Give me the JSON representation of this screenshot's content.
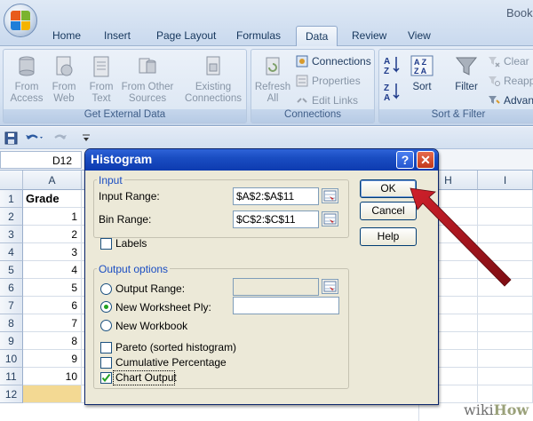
{
  "window": {
    "book_title": "Book"
  },
  "ribbon": {
    "tabs": [
      "Home",
      "Insert",
      "Page Layout",
      "Formulas",
      "Data",
      "Review",
      "View"
    ],
    "active_tab": "Data",
    "get_external_data": {
      "label": "Get External Data",
      "buttons": [
        {
          "line1": "From",
          "line2": "Access",
          "icon": "database-icon"
        },
        {
          "line1": "From",
          "line2": "Web",
          "icon": "globe-page-icon"
        },
        {
          "line1": "From",
          "line2": "Text",
          "icon": "text-file-icon"
        },
        {
          "line1": "From Other",
          "line2": "Sources",
          "icon": "other-sources-icon"
        },
        {
          "line1": "Existing",
          "line2": "Connections",
          "icon": "existing-connections-icon"
        }
      ]
    },
    "connections": {
      "label": "Connections",
      "refresh_line1": "Refresh",
      "refresh_line2": "All",
      "items": [
        "Connections",
        "Properties",
        "Edit Links"
      ]
    },
    "sort_filter": {
      "label": "Sort & Filter",
      "sort": "Sort",
      "filter": "Filter",
      "items": [
        "Clear",
        "Reapply",
        "Advanced"
      ]
    }
  },
  "name_box": "D12",
  "sheet": {
    "columns": [
      "A",
      "H",
      "I"
    ],
    "rows": [
      "1",
      "2",
      "3",
      "4",
      "5",
      "6",
      "7",
      "8",
      "9",
      "10",
      "11",
      "12"
    ],
    "a_values": [
      "Grade",
      "1",
      "2",
      "3",
      "4",
      "5",
      "6",
      "7",
      "8",
      "9",
      "10",
      ""
    ]
  },
  "dialog": {
    "title": "Histogram",
    "input_legend": "Input",
    "input_range_label": "Input Range:",
    "input_range_value": "$A$2:$A$11",
    "bin_range_label": "Bin Range:",
    "bin_range_value": "$C$2:$C$11",
    "labels_label": "Labels",
    "output_legend": "Output options",
    "output_range_label": "Output Range:",
    "new_ply_label": "New Worksheet Ply:",
    "new_workbook_label": "New Workbook",
    "pareto_label": "Pareto (sorted histogram)",
    "cumulative_label": "Cumulative Percentage",
    "chart_output_label": "Chart Output",
    "ok": "OK",
    "cancel": "Cancel",
    "help": "Help",
    "selected_output": "New Worksheet Ply",
    "chart_output_checked": true
  },
  "watermark": {
    "wiki": "wiki",
    "how": "How"
  },
  "colors": {
    "arrow": "#b0141d",
    "title_bar": "#1a4dc2",
    "accent": "#21a121"
  }
}
